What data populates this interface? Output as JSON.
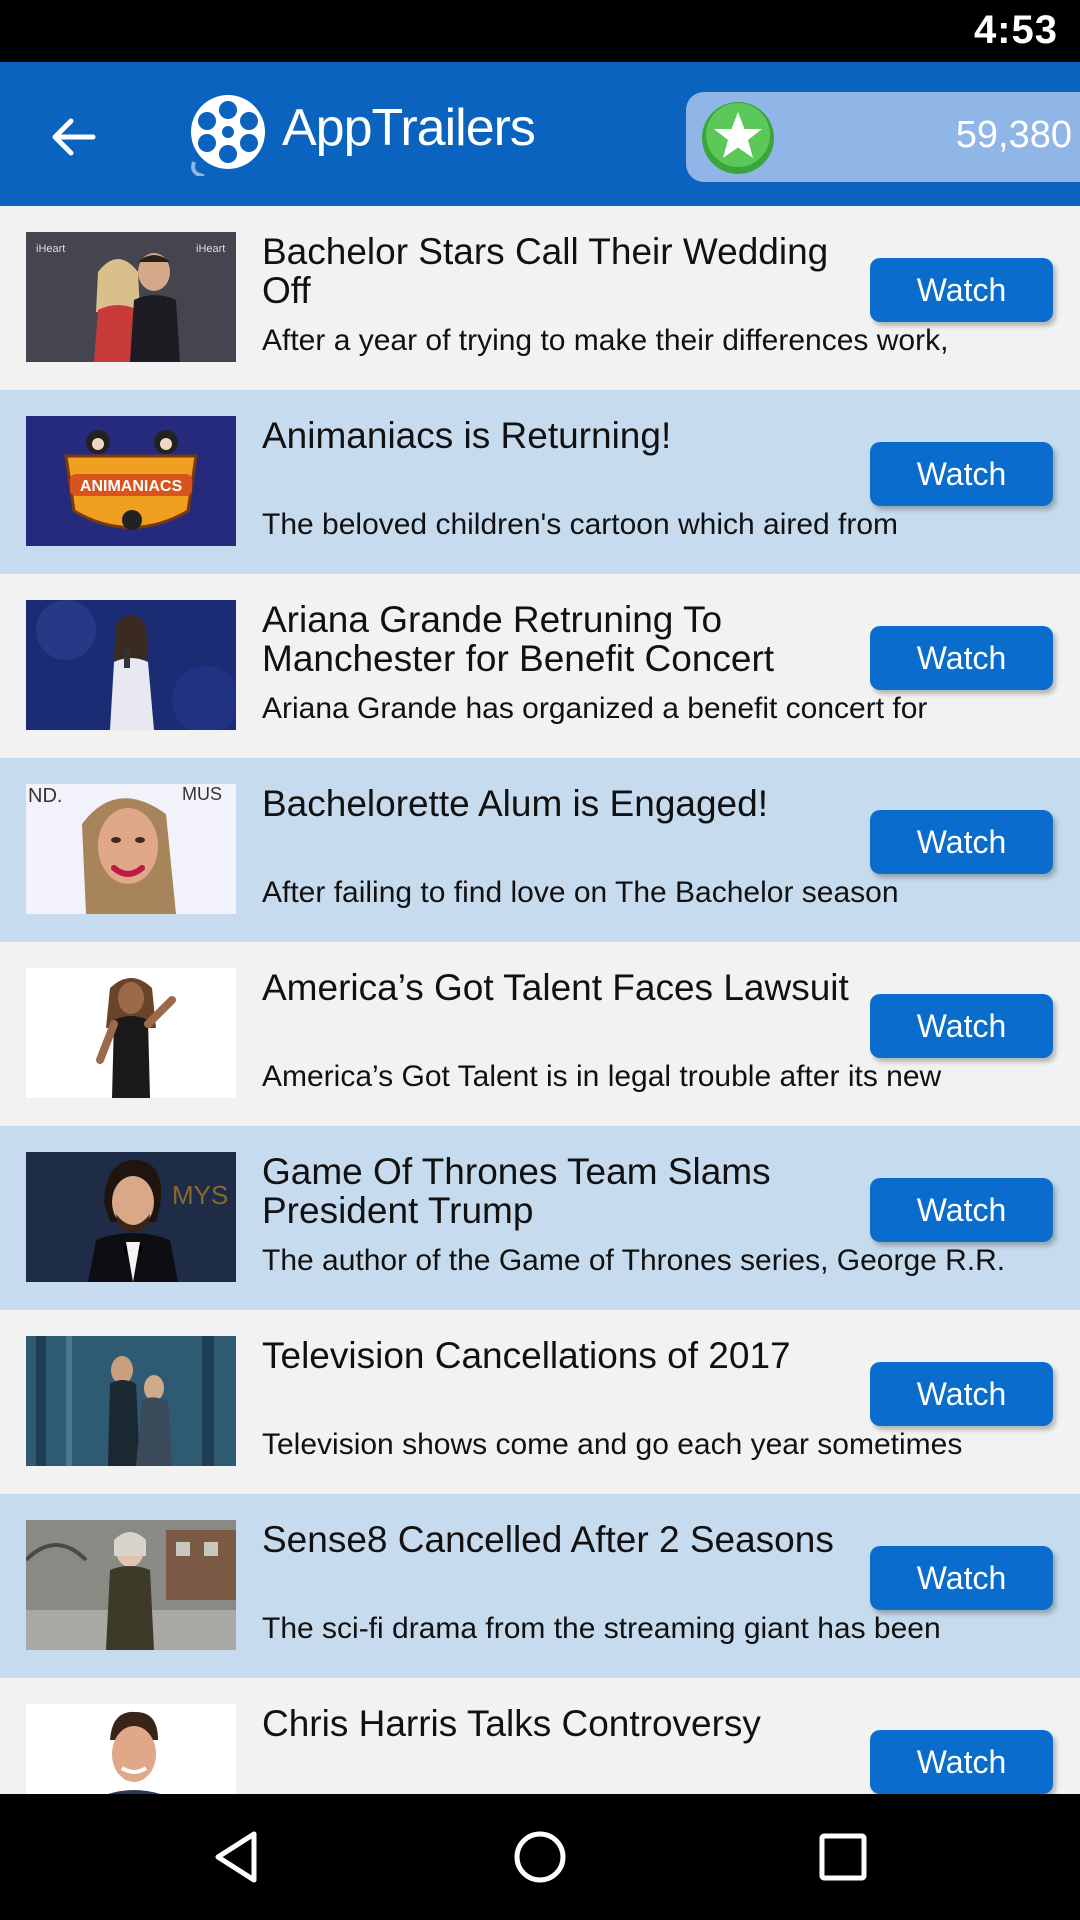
{
  "status_bar": {
    "time": "4:53"
  },
  "header": {
    "title": "AppTrailers",
    "points": "59,380",
    "accent_color": "#0a63bf"
  },
  "items": [
    {
      "title": "Bachelor Stars Call Their Wedding Off",
      "description": "After a year of trying to make their differences work,",
      "button": "Watch",
      "thumb": "couple-red-carpet"
    },
    {
      "title": "Animaniacs is Returning!",
      "description": "The beloved children's cartoon which aired from",
      "button": "Watch",
      "thumb": "animaniacs-logo"
    },
    {
      "title": "Ariana Grande Retruning To Manchester for Benefit Concert",
      "description": "Ariana Grande has organized a benefit concert for",
      "button": "Watch",
      "thumb": "singer-on-stage"
    },
    {
      "title": "Bachelorette Alum is Engaged!",
      "description": "After failing to find love on The Bachelor season",
      "button": "Watch",
      "thumb": "smiling-woman"
    },
    {
      "title": "America’s Got Talent Faces Lawsuit",
      "description": "America’s Got Talent is in legal trouble after its new",
      "button": "Watch",
      "thumb": "woman-posing"
    },
    {
      "title": "Game Of Thrones Team Slams President Trump",
      "description": "The author of the Game of Thrones series, George R.R.",
      "button": "Watch",
      "thumb": "man-in-tuxedo"
    },
    {
      "title": "Television Cancellations of 2017",
      "description": "Television shows come and go each year sometimes",
      "button": "Watch",
      "thumb": "forest-scene"
    },
    {
      "title": "Sense8 Cancelled After 2 Seasons",
      "description": "The sci-fi drama from the streaming giant has been",
      "button": "Watch",
      "thumb": "woman-outdoors"
    },
    {
      "title": "Chris Harris Talks Controversy",
      "description": "",
      "button": "Watch",
      "thumb": "man-portrait"
    }
  ],
  "colors": {
    "row_alt": "#c6dbee",
    "row_plain": "#f2f2f2",
    "button": "#0a6ccc"
  }
}
